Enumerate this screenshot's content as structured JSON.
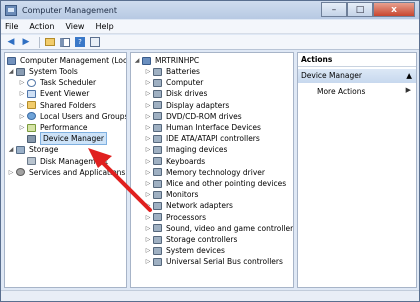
{
  "window": {
    "title": "Computer Management",
    "minimize": "–",
    "maximize": "□",
    "close": "x"
  },
  "menu": [
    "File",
    "Action",
    "View",
    "Help"
  ],
  "toolbar": {
    "icons": [
      "back-arrow",
      "forward-arrow",
      "up-folder",
      "show-hide-tree",
      "help",
      "properties"
    ]
  },
  "left_tree": {
    "root": "Computer Management (Local",
    "items": [
      {
        "label": "System Tools",
        "indent": 1,
        "expander": "◢",
        "icon": "tool"
      },
      {
        "label": "Task Scheduler",
        "indent": 2,
        "expander": "▷",
        "icon": "clock"
      },
      {
        "label": "Event Viewer",
        "indent": 2,
        "expander": "▷",
        "icon": "event"
      },
      {
        "label": "Shared Folders",
        "indent": 2,
        "expander": "▷",
        "icon": "folder"
      },
      {
        "label": "Local Users and Groups",
        "indent": 2,
        "expander": "▷",
        "icon": "users"
      },
      {
        "label": "Performance",
        "indent": 2,
        "expander": "▷",
        "icon": "perf"
      },
      {
        "label": "Device Manager",
        "indent": 2,
        "expander": "",
        "icon": "devmgr",
        "selected": true
      },
      {
        "label": "Storage",
        "indent": 1,
        "expander": "◢",
        "icon": "storage"
      },
      {
        "label": "Disk Management",
        "indent": 2,
        "expander": "",
        "icon": "disk"
      },
      {
        "label": "Services and Applications",
        "indent": 1,
        "expander": "▷",
        "icon": "service"
      }
    ]
  },
  "device_tree": {
    "root": "MRTRINHPC",
    "items": [
      "Batteries",
      "Computer",
      "Disk drives",
      "Display adapters",
      "DVD/CD-ROM drives",
      "Human Interface Devices",
      "IDE ATA/ATAPI controllers",
      "Imaging devices",
      "Keyboards",
      "Memory technology driver",
      "Mice and other pointing devices",
      "Monitors",
      "Network adapters",
      "Processors",
      "Sound, video and game controllers",
      "Storage controllers",
      "System devices",
      "Universal Serial Bus controllers"
    ]
  },
  "actions": {
    "header": "Actions",
    "group": "Device Manager",
    "group_arrow": "▲",
    "more": "More Actions",
    "more_arrow": "▶"
  },
  "colors": {
    "annotation_arrow": "#e0201f",
    "selection": "#cde3f8"
  }
}
